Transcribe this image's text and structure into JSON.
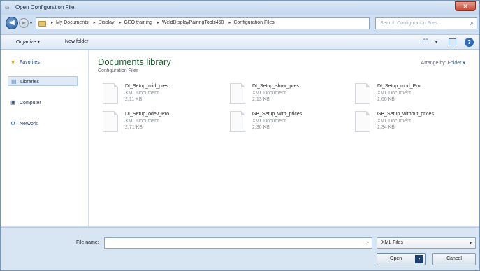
{
  "window": {
    "title": "Open Configuration File",
    "close_label": "✕"
  },
  "address": {
    "crumbs": [
      "My Documents",
      "Display",
      "GEO training",
      "WeldDisplayPairingTools450",
      "Configuration Files"
    ],
    "search_placeholder": "Search Configuration Files"
  },
  "toolbar": {
    "organize": "Organize ▾",
    "new_folder": "New folder"
  },
  "nav": {
    "favorites": "Favorites",
    "libraries": "Libraries",
    "computer": "Computer",
    "network": "Network"
  },
  "library": {
    "title": "Documents library",
    "subtitle": "Configuration Files",
    "arrange_label": "Arrange by:",
    "arrange_value": "Folder ▾"
  },
  "files": [
    {
      "name": "DI_Setup_mid_pres",
      "type": "XML Document",
      "size": "2,11 KB"
    },
    {
      "name": "DI_Setup_show_pres",
      "type": "XML Document",
      "size": "2,13 KB"
    },
    {
      "name": "DI_Setup_mod_Pro",
      "type": "XML Document",
      "size": "2,60 KB"
    },
    {
      "name": "DI_Setup_odev_Pro",
      "type": "XML Document",
      "size": "2,71 KB"
    },
    {
      "name": "GB_Setup_with_prices",
      "type": "XML Document",
      "size": "2,36 KB"
    },
    {
      "name": "GB_Setup_without_prices",
      "type": "XML Document",
      "size": "2,34 KB"
    }
  ],
  "footer": {
    "file_name_label": "File name:",
    "file_name_value": "",
    "file_type": "XML Files",
    "open_label": "Open",
    "cancel_label": "Cancel"
  }
}
